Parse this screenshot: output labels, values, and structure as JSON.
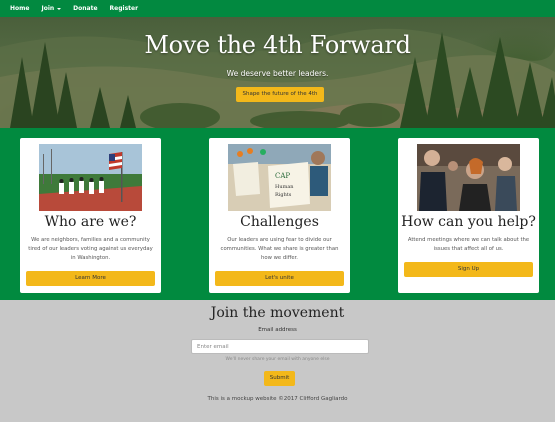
{
  "nav": {
    "items": [
      {
        "label": "Home"
      },
      {
        "label": "Join"
      },
      {
        "label": "Donate"
      },
      {
        "label": "Register"
      }
    ]
  },
  "hero": {
    "title": "Move the 4th Forward",
    "subtitle": "We deserve better leaders.",
    "button": "Shape the future of the 4th"
  },
  "cards": [
    {
      "title": "Who are we?",
      "text": "We are neighbors, families and a community tired of our leaders voting against us everyday in Washington.",
      "button": "Learn More"
    },
    {
      "title": "Challenges",
      "text": "Our leaders are using fear to divide our communities. What we share is greater than how we differ.",
      "button": "Let's unite"
    },
    {
      "title": "How can you help?",
      "text": "Attend meetings where we can talk about the issues that affect all of us.",
      "button": "Sign Up"
    }
  ],
  "signup": {
    "title": "Join the movement",
    "email_label": "Email address",
    "email_placeholder": "Enter email",
    "email_help": "We'll never share your email with anyone else",
    "submit": "Submit"
  },
  "footer": {
    "copyright": "This is a mockup website ©2017 Clifford Gagliardo"
  },
  "colors": {
    "nav_green": "#028940",
    "section_green": "#018a3f",
    "accent_yellow": "#f3b81a",
    "footer_gray": "#c8c8c8"
  }
}
